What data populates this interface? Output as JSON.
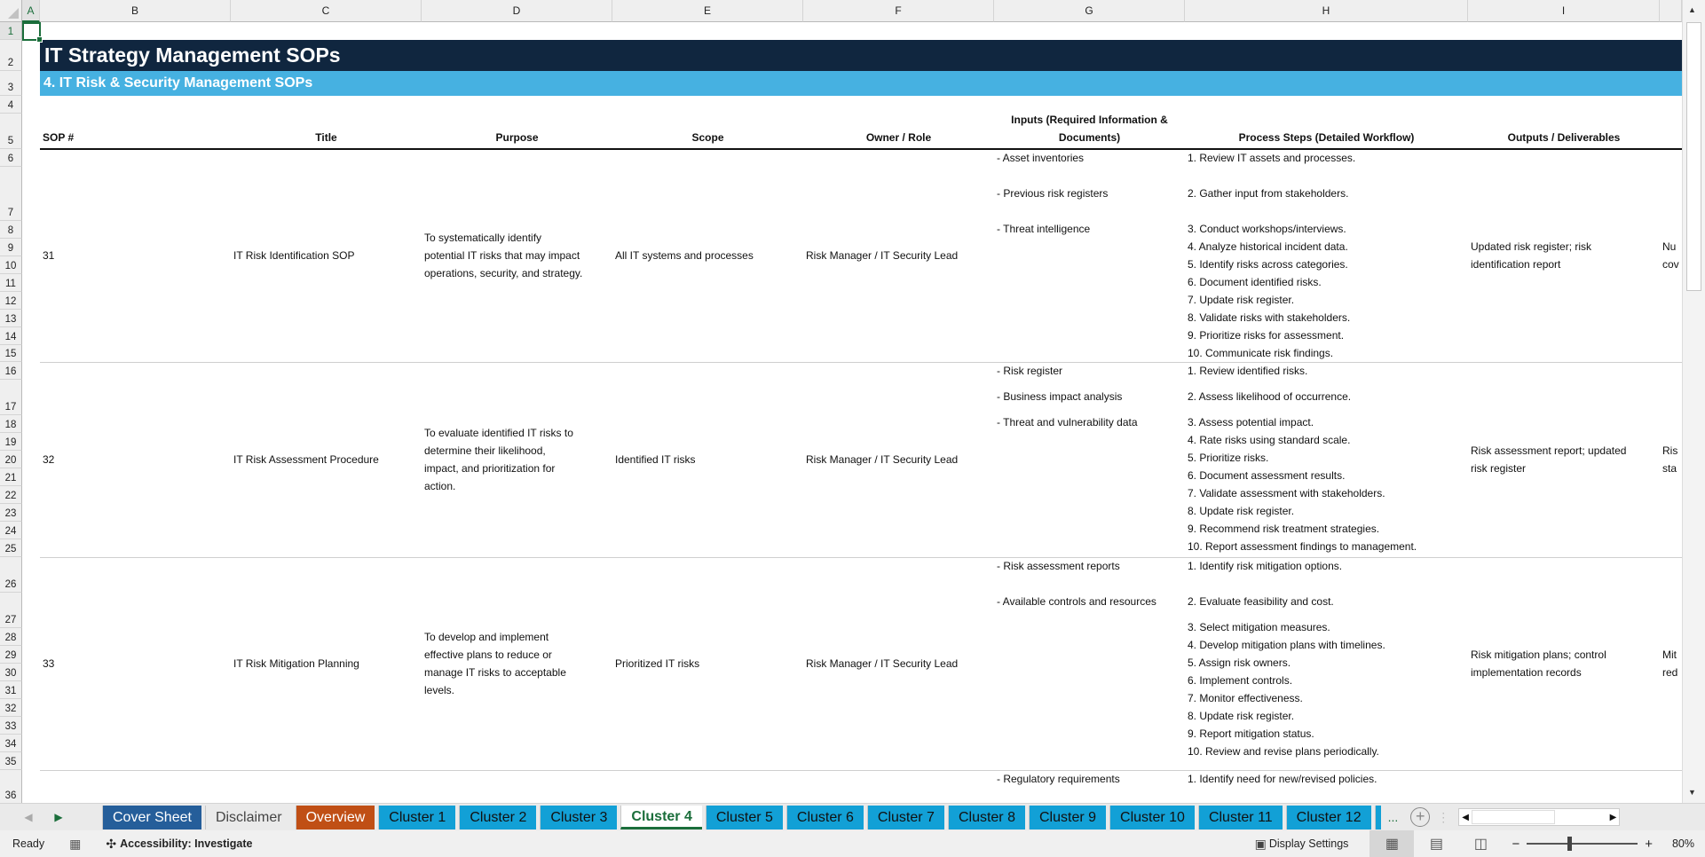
{
  "sheet": {
    "columns": [
      "A",
      "B",
      "C",
      "D",
      "E",
      "F",
      "G",
      "H",
      "I",
      ""
    ],
    "rows": [
      "1",
      "2",
      "3",
      "4",
      "5",
      "6",
      "7",
      "8",
      "9",
      "10",
      "11",
      "12",
      "13",
      "14",
      "15",
      "16",
      "17",
      "18",
      "19",
      "20",
      "21",
      "22",
      "23",
      "24",
      "25",
      "26",
      "27",
      "28",
      "29",
      "30",
      "31",
      "32",
      "33",
      "34",
      "35",
      "36"
    ],
    "title": "IT Strategy Management SOPs",
    "subtitle": "4. IT Risk & Security Management SOPs",
    "headers": {
      "sop": "SOP #",
      "title": "Title",
      "purpose": "Purpose",
      "scope": "Scope",
      "owner": "Owner / Role",
      "inputs": "Inputs (Required Information & Documents)",
      "steps": "Process Steps (Detailed Workflow)",
      "outputs": "Outputs / Deliverables"
    },
    "sops": [
      {
        "sop": "31",
        "title": "IT Risk Identification SOP",
        "purpose": "To systematically identify\npotential IT risks that may impact\noperations, security, and strategy.",
        "scope": "All IT systems and processes",
        "owner": "Risk Manager / IT Security Lead",
        "inputs": [
          "- Asset inventories",
          "",
          "- Previous risk registers",
          "",
          "- Threat intelligence"
        ],
        "steps": [
          "1. Review IT assets and processes.",
          "",
          "2. Gather input from stakeholders.",
          "",
          "3. Conduct workshops/interviews.",
          "4. Analyze historical incident data.",
          "5. Identify risks across categories.",
          "6. Document identified risks.",
          "7. Update risk register.",
          "8. Validate risks with stakeholders.",
          "9. Prioritize risks for assessment.",
          "10. Communicate risk findings."
        ],
        "outputs": "Updated risk register; risk\nidentification report",
        "next_col": "Nu\ncov"
      },
      {
        "sop": "32",
        "title": "IT Risk Assessment Procedure",
        "purpose": "To evaluate identified IT risks to\ndetermine their likelihood,\nimpact, and prioritization for\naction.",
        "scope": "Identified IT risks",
        "owner": "Risk Manager / IT Security Lead",
        "inputs": [
          "- Risk register",
          "",
          "- Business impact analysis",
          "",
          "- Threat and vulnerability data"
        ],
        "steps": [
          "1. Review identified risks.",
          "",
          "2. Assess likelihood of occurrence.",
          "",
          "3. Assess potential impact.",
          "4. Rate risks using standard scale.",
          "5. Prioritize risks.",
          "6. Document assessment results.",
          "7. Validate assessment with stakeholders.",
          "8. Update risk register.",
          "9. Recommend risk treatment strategies.",
          "10. Report assessment findings to management."
        ],
        "outputs": "Risk assessment report; updated\nrisk register",
        "next_col": "Ris\nsta"
      },
      {
        "sop": "33",
        "title": "IT Risk Mitigation Planning",
        "purpose": "To develop and implement\neffective plans to reduce or\nmanage IT risks to acceptable\nlevels.",
        "scope": "Prioritized IT risks",
        "owner": "Risk Manager / IT Security Lead",
        "inputs": [
          "- Risk assessment reports",
          "",
          "- Available controls and resources"
        ],
        "steps": [
          "1. Identify risk mitigation options.",
          "",
          "2. Evaluate feasibility and cost.",
          "",
          "3. Select mitigation measures.",
          "4. Develop mitigation plans with timelines.",
          "5. Assign risk owners.",
          "6. Implement controls.",
          "7. Monitor effectiveness.",
          "8. Update risk register.",
          "9. Report mitigation status.",
          "10. Review and revise plans periodically."
        ],
        "outputs": "Risk mitigation plans; control\nimplementation records",
        "next_col": "Mit\nred"
      },
      {
        "sop": "",
        "title": "",
        "purpose": "",
        "scope": "",
        "owner": "",
        "inputs": [
          "- Regulatory requirements"
        ],
        "steps": [
          "1. Identify need for new/revised policies."
        ],
        "outputs": "",
        "next_col": ""
      }
    ]
  },
  "tabs": {
    "items": [
      {
        "label": "Cover Sheet",
        "style": "dark"
      },
      {
        "label": "Disclaimer",
        "style": "plain"
      },
      {
        "label": "Overview",
        "style": "orange"
      },
      {
        "label": "Cluster 1",
        "style": "blue"
      },
      {
        "label": "Cluster 2",
        "style": "blue"
      },
      {
        "label": "Cluster 3",
        "style": "blue"
      },
      {
        "label": "Cluster 4",
        "style": "active"
      },
      {
        "label": "Cluster 5",
        "style": "blue"
      },
      {
        "label": "Cluster 6",
        "style": "blue"
      },
      {
        "label": "Cluster 7",
        "style": "blue"
      },
      {
        "label": "Cluster 8",
        "style": "blue"
      },
      {
        "label": "Cluster 9",
        "style": "blue"
      },
      {
        "label": "Cluster 10",
        "style": "blue"
      },
      {
        "label": "Cluster 11",
        "style": "blue"
      },
      {
        "label": "Cluster 12",
        "style": "blue"
      }
    ],
    "more": "...",
    "colors": {
      "dark": "#255e9a",
      "orange": "#c04f15",
      "blue": "#12a0d6",
      "active_text": "#1b6e3b"
    }
  },
  "status": {
    "ready": "Ready",
    "accessibility": "Accessibility: Investigate",
    "display_settings": "Display Settings",
    "zoom": "80%"
  },
  "colors": {
    "title_bg": "#10263f",
    "subtitle_bg": "#46b1e1"
  }
}
